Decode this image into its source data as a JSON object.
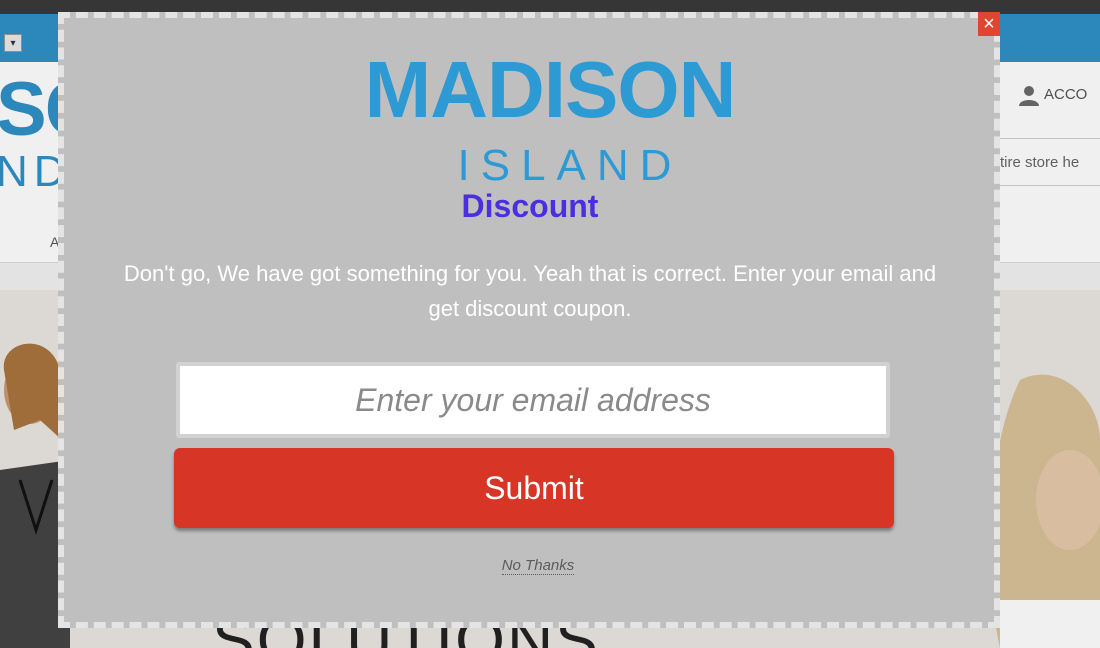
{
  "background_site": {
    "logo_fragment_top": "SC",
    "logo_fragment_bottom": "ND",
    "account_label": "ACCO",
    "search_fragment": "tire store he",
    "nav_fragment": "A",
    "hero_fragment": "SOLUTIONS",
    "lang_select_glyph": "▾"
  },
  "popup": {
    "close_glyph": "×",
    "brand_top": "MADISON",
    "brand_bottom": "ISLAND",
    "title": "Discount",
    "message": "Don't go, We have got something for you. Yeah that is correct. Enter your email and get discount coupon.",
    "email_placeholder": "Enter your email address",
    "submit_label": "Submit",
    "no_thanks_label": "No Thanks"
  },
  "colors": {
    "brand_blue": "#2e9ad4",
    "title_purple": "#4a2ee0",
    "submit_red": "#d73526",
    "close_red": "#e2452f",
    "popup_bg": "#bfbfbf"
  },
  "icons": [
    "account-icon",
    "close-icon"
  ]
}
